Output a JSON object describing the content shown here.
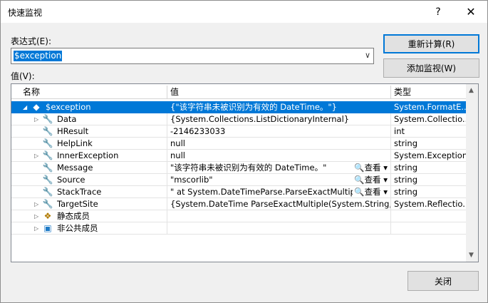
{
  "window": {
    "title": "快速监视",
    "help": "?",
    "close": "✕"
  },
  "expression": {
    "label": "表达式(E):",
    "value": "$exception"
  },
  "buttons": {
    "recalc": "重新计算(R)",
    "add_watch": "添加监视(W)",
    "close": "关闭"
  },
  "value_label": "值(V):",
  "columns": {
    "name": "名称",
    "value": "值",
    "type": "类型"
  },
  "viewer_label": "查看",
  "rows": [
    {
      "name": "$exception",
      "value": "{\"该字符串未被识别为有效的 DateTime。\"}",
      "type": "System.FormatE..."
    },
    {
      "name": "Data",
      "value": "{System.Collections.ListDictionaryInternal}",
      "type": "System.Collectio..."
    },
    {
      "name": "HResult",
      "value": "-2146233033",
      "type": "int"
    },
    {
      "name": "HelpLink",
      "value": "null",
      "type": "string"
    },
    {
      "name": "InnerException",
      "value": "null",
      "type": "System.Exception"
    },
    {
      "name": "Message",
      "value": "\"该字符串未被识别为有效的 DateTime。\"",
      "type": "string"
    },
    {
      "name": "Source",
      "value": "\"mscorlib\"",
      "type": "string"
    },
    {
      "name": "StackTrace",
      "value": "\"   at System.DateTimeParse.ParseExactMultipl...",
      "type": "string"
    },
    {
      "name": "TargetSite",
      "value": "{System.DateTime ParseExactMultiple(System.String, Sys...",
      "type": "System.Reflectio..."
    },
    {
      "name": "静态成员",
      "value": "",
      "type": ""
    },
    {
      "name": "非公共成员",
      "value": "",
      "type": ""
    }
  ]
}
